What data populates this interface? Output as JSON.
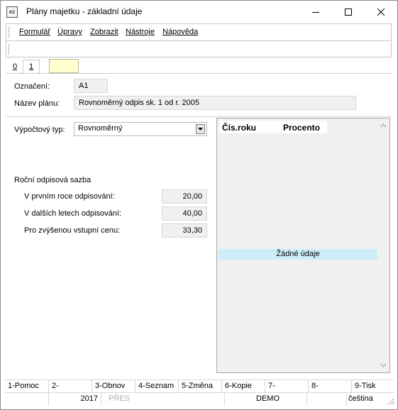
{
  "window": {
    "icon_text": "K2",
    "title": "Plány majetku - základní údaje"
  },
  "menu": {
    "items": [
      "Formulář",
      "Úpravy",
      "Zobrazit",
      "Nástroje",
      "Nápověda"
    ]
  },
  "tabs": {
    "tab0": "0",
    "tab1": "1"
  },
  "header": {
    "oznaceni_label": "Označení:",
    "oznaceni_value": "A1",
    "nazev_label": "Název plánu:",
    "nazev_value": "Rovnoměrný odpis sk. 1 od r. 2005"
  },
  "left": {
    "typ_label": "Výpočtový typ:",
    "typ_value": "Rovnoměrný",
    "sazba_heading": "Roční odpisová sazba",
    "rows": [
      {
        "label": "V prvním roce odpisování:",
        "value": "20,00"
      },
      {
        "label": "V dalších letech odpisování:",
        "value": "40,00"
      },
      {
        "label": "Pro zvýšenou vstupní cenu:",
        "value": "33,30"
      }
    ]
  },
  "grid": {
    "col1": "Čís.roku",
    "col2": "Procento",
    "empty_text": "Žádné údaje"
  },
  "fkeys": [
    "1-Pomoc",
    "2-",
    "3-Obnov",
    "4-Seznam",
    "5-Změna",
    "6-Kopie",
    "7-",
    "8-",
    "9-Tisk"
  ],
  "status": {
    "year": "2017",
    "mode": "PŘES",
    "db": "DEMO",
    "lang": "čeština"
  },
  "colors": {
    "readonly_bg": "#f0f0f0",
    "nodata_bg": "#cdeef9",
    "yellow_tab": "#ffffd0"
  }
}
